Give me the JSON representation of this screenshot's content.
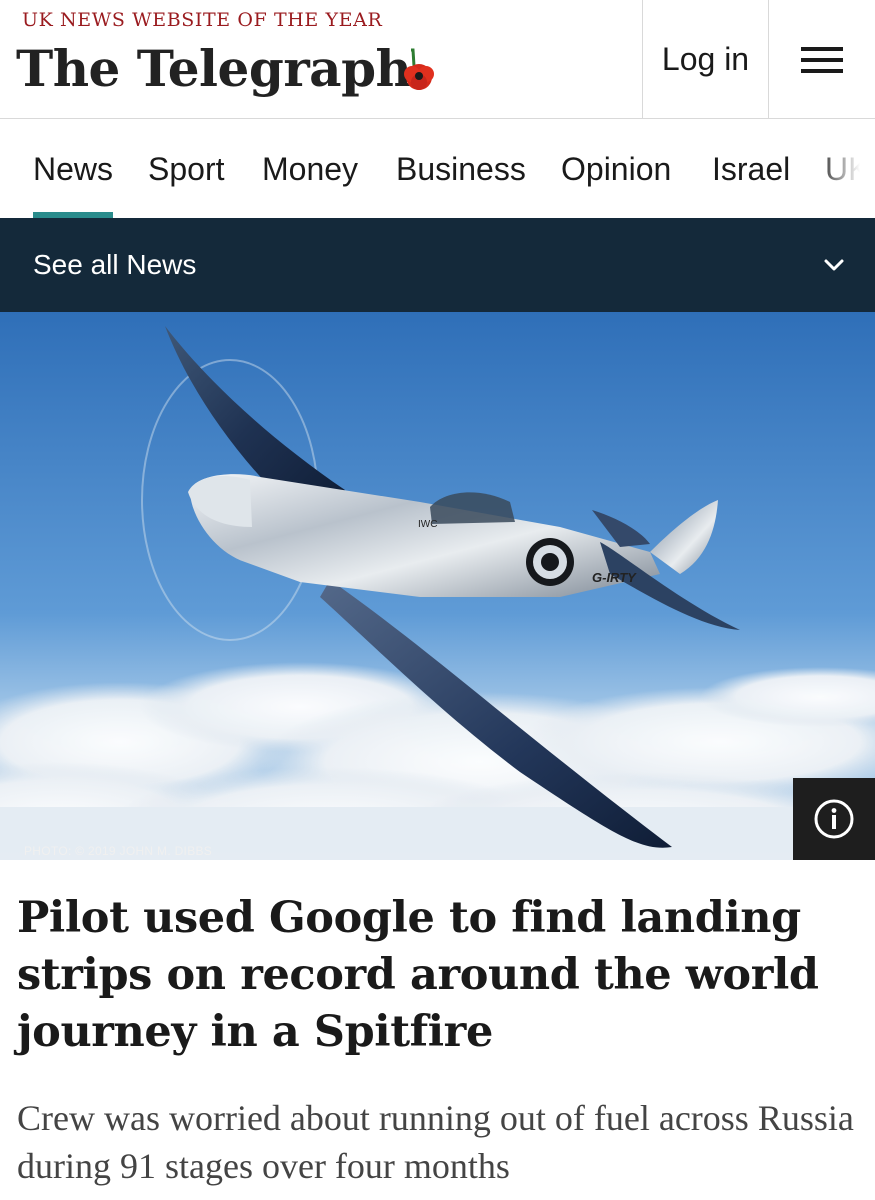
{
  "header": {
    "tagline": "UK NEWS WEBSITE OF THE YEAR",
    "logo_text": "The Telegraph",
    "login_label": "Log in",
    "menu_icon": "hamburger-menu-icon"
  },
  "nav": {
    "items": [
      {
        "label": "News",
        "active": true
      },
      {
        "label": "Sport"
      },
      {
        "label": "Money"
      },
      {
        "label": "Business"
      },
      {
        "label": "Opinion"
      },
      {
        "label": "Israel"
      },
      {
        "label": "UK"
      }
    ]
  },
  "subnav": {
    "label": "See all News",
    "icon": "chevron-down-icon"
  },
  "hero": {
    "credit": "PHOTO: © 2019 JOHN M. DIBBS",
    "aircraft_markings": {
      "brand": "IWC",
      "registration": "G-IRTY"
    },
    "info_icon": "info-icon"
  },
  "article": {
    "headline": "Pilot used Google to find landing strips on record around the world journey in a Spitfire",
    "standfirst": "Crew was worried about running out of fuel across Russia during 91 stages over four months"
  },
  "colors": {
    "accent_underline": "#2a8c8c",
    "subnav_bg": "#14293a",
    "tagline": "#9a1b1f",
    "poppy": "#d42a1a"
  }
}
